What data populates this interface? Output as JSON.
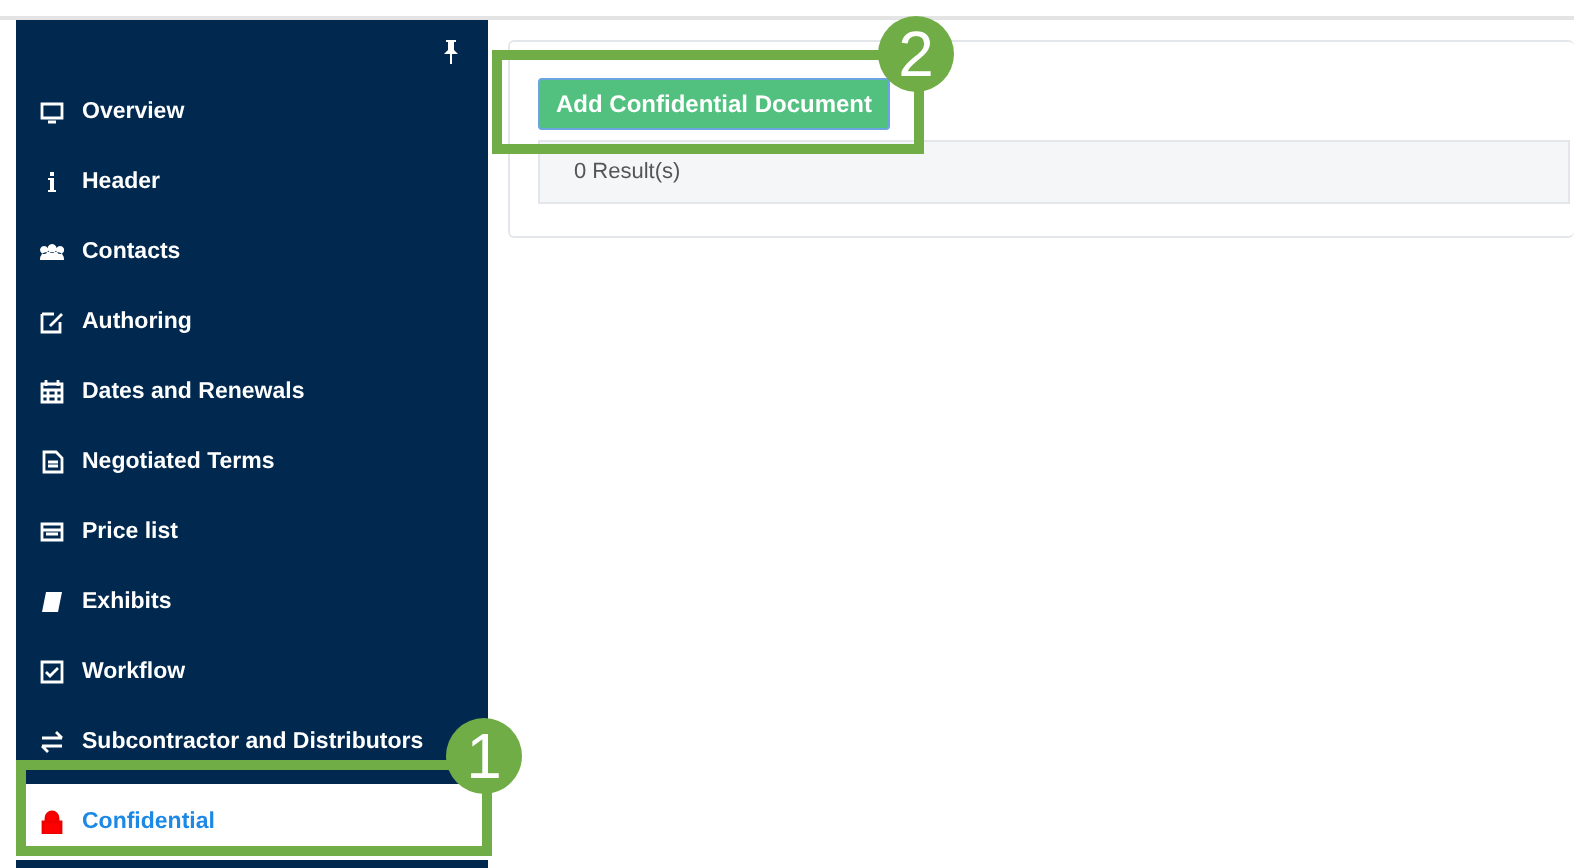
{
  "sidebar": {
    "items": [
      {
        "label": "Overview",
        "selected": false
      },
      {
        "label": "Header",
        "selected": false
      },
      {
        "label": "Contacts",
        "selected": false
      },
      {
        "label": "Authoring",
        "selected": false
      },
      {
        "label": "Dates and Renewals",
        "selected": false
      },
      {
        "label": "Negotiated Terms",
        "selected": false
      },
      {
        "label": "Price list",
        "selected": false
      },
      {
        "label": "Exhibits",
        "selected": false
      },
      {
        "label": "Workflow",
        "selected": false
      },
      {
        "label": "Subcontractor and Distributors",
        "selected": false
      },
      {
        "label": "Confidential",
        "selected": true
      }
    ]
  },
  "main": {
    "button": "Add Confidential Document",
    "results": "0 Result(s)"
  },
  "callouts": [
    {
      "number": "1"
    },
    {
      "number": "2"
    }
  ]
}
